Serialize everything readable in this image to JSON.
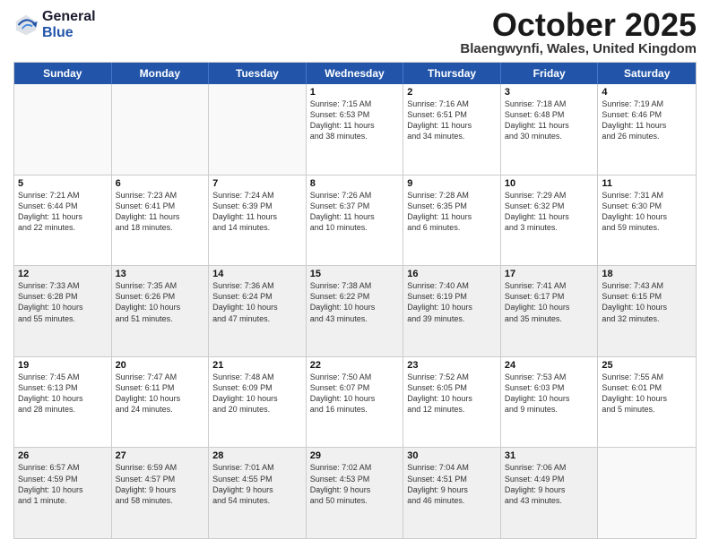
{
  "logo": {
    "general": "General",
    "blue": "Blue"
  },
  "title": {
    "month": "October 2025",
    "location": "Blaengwynfi, Wales, United Kingdom"
  },
  "days": [
    "Sunday",
    "Monday",
    "Tuesday",
    "Wednesday",
    "Thursday",
    "Friday",
    "Saturday"
  ],
  "rows": [
    [
      {
        "day": "",
        "info": "",
        "empty": true
      },
      {
        "day": "",
        "info": "",
        "empty": true
      },
      {
        "day": "",
        "info": "",
        "empty": true
      },
      {
        "day": "1",
        "info": "Sunrise: 7:15 AM\nSunset: 6:53 PM\nDaylight: 11 hours\nand 38 minutes."
      },
      {
        "day": "2",
        "info": "Sunrise: 7:16 AM\nSunset: 6:51 PM\nDaylight: 11 hours\nand 34 minutes."
      },
      {
        "day": "3",
        "info": "Sunrise: 7:18 AM\nSunset: 6:48 PM\nDaylight: 11 hours\nand 30 minutes."
      },
      {
        "day": "4",
        "info": "Sunrise: 7:19 AM\nSunset: 6:46 PM\nDaylight: 11 hours\nand 26 minutes."
      }
    ],
    [
      {
        "day": "5",
        "info": "Sunrise: 7:21 AM\nSunset: 6:44 PM\nDaylight: 11 hours\nand 22 minutes."
      },
      {
        "day": "6",
        "info": "Sunrise: 7:23 AM\nSunset: 6:41 PM\nDaylight: 11 hours\nand 18 minutes."
      },
      {
        "day": "7",
        "info": "Sunrise: 7:24 AM\nSunset: 6:39 PM\nDaylight: 11 hours\nand 14 minutes."
      },
      {
        "day": "8",
        "info": "Sunrise: 7:26 AM\nSunset: 6:37 PM\nDaylight: 11 hours\nand 10 minutes."
      },
      {
        "day": "9",
        "info": "Sunrise: 7:28 AM\nSunset: 6:35 PM\nDaylight: 11 hours\nand 6 minutes."
      },
      {
        "day": "10",
        "info": "Sunrise: 7:29 AM\nSunset: 6:32 PM\nDaylight: 11 hours\nand 3 minutes."
      },
      {
        "day": "11",
        "info": "Sunrise: 7:31 AM\nSunset: 6:30 PM\nDaylight: 10 hours\nand 59 minutes."
      }
    ],
    [
      {
        "day": "12",
        "info": "Sunrise: 7:33 AM\nSunset: 6:28 PM\nDaylight: 10 hours\nand 55 minutes."
      },
      {
        "day": "13",
        "info": "Sunrise: 7:35 AM\nSunset: 6:26 PM\nDaylight: 10 hours\nand 51 minutes."
      },
      {
        "day": "14",
        "info": "Sunrise: 7:36 AM\nSunset: 6:24 PM\nDaylight: 10 hours\nand 47 minutes."
      },
      {
        "day": "15",
        "info": "Sunrise: 7:38 AM\nSunset: 6:22 PM\nDaylight: 10 hours\nand 43 minutes."
      },
      {
        "day": "16",
        "info": "Sunrise: 7:40 AM\nSunset: 6:19 PM\nDaylight: 10 hours\nand 39 minutes."
      },
      {
        "day": "17",
        "info": "Sunrise: 7:41 AM\nSunset: 6:17 PM\nDaylight: 10 hours\nand 35 minutes."
      },
      {
        "day": "18",
        "info": "Sunrise: 7:43 AM\nSunset: 6:15 PM\nDaylight: 10 hours\nand 32 minutes."
      }
    ],
    [
      {
        "day": "19",
        "info": "Sunrise: 7:45 AM\nSunset: 6:13 PM\nDaylight: 10 hours\nand 28 minutes."
      },
      {
        "day": "20",
        "info": "Sunrise: 7:47 AM\nSunset: 6:11 PM\nDaylight: 10 hours\nand 24 minutes."
      },
      {
        "day": "21",
        "info": "Sunrise: 7:48 AM\nSunset: 6:09 PM\nDaylight: 10 hours\nand 20 minutes."
      },
      {
        "day": "22",
        "info": "Sunrise: 7:50 AM\nSunset: 6:07 PM\nDaylight: 10 hours\nand 16 minutes."
      },
      {
        "day": "23",
        "info": "Sunrise: 7:52 AM\nSunset: 6:05 PM\nDaylight: 10 hours\nand 12 minutes."
      },
      {
        "day": "24",
        "info": "Sunrise: 7:53 AM\nSunset: 6:03 PM\nDaylight: 10 hours\nand 9 minutes."
      },
      {
        "day": "25",
        "info": "Sunrise: 7:55 AM\nSunset: 6:01 PM\nDaylight: 10 hours\nand 5 minutes."
      }
    ],
    [
      {
        "day": "26",
        "info": "Sunrise: 6:57 AM\nSunset: 4:59 PM\nDaylight: 10 hours\nand 1 minute."
      },
      {
        "day": "27",
        "info": "Sunrise: 6:59 AM\nSunset: 4:57 PM\nDaylight: 9 hours\nand 58 minutes."
      },
      {
        "day": "28",
        "info": "Sunrise: 7:01 AM\nSunset: 4:55 PM\nDaylight: 9 hours\nand 54 minutes."
      },
      {
        "day": "29",
        "info": "Sunrise: 7:02 AM\nSunset: 4:53 PM\nDaylight: 9 hours\nand 50 minutes."
      },
      {
        "day": "30",
        "info": "Sunrise: 7:04 AM\nSunset: 4:51 PM\nDaylight: 9 hours\nand 46 minutes."
      },
      {
        "day": "31",
        "info": "Sunrise: 7:06 AM\nSunset: 4:49 PM\nDaylight: 9 hours\nand 43 minutes."
      },
      {
        "day": "",
        "info": "",
        "empty": true
      }
    ]
  ]
}
